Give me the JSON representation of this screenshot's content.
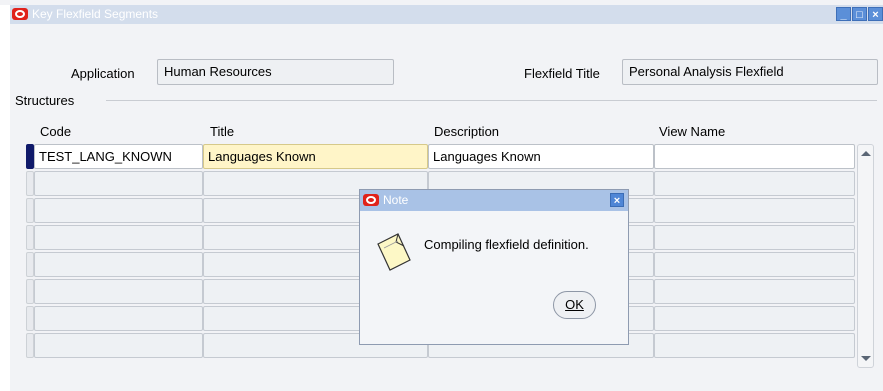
{
  "window": {
    "title": "Key Flexfield Segments",
    "controls": [
      "minimize",
      "maximize",
      "close"
    ]
  },
  "header": {
    "application_label": "Application",
    "application_value": "Human Resources",
    "flexfield_title_label": "Flexfield Title",
    "flexfield_title_value": "Personal Analysis Flexfield"
  },
  "structures": {
    "group_label": "Structures",
    "columns": [
      "Code",
      "Title",
      "Description",
      "View Name"
    ],
    "rows": [
      {
        "code": "TEST_LANG_KNOWN",
        "title": "Languages Known",
        "description": "Languages Known",
        "view_name": ""
      },
      {
        "code": "",
        "title": "",
        "description": "",
        "view_name": ""
      },
      {
        "code": "",
        "title": "",
        "description": "",
        "view_name": ""
      },
      {
        "code": "",
        "title": "",
        "description": "",
        "view_name": ""
      },
      {
        "code": "",
        "title": "",
        "description": "",
        "view_name": ""
      },
      {
        "code": "",
        "title": "",
        "description": "",
        "view_name": ""
      },
      {
        "code": "",
        "title": "",
        "description": "",
        "view_name": ""
      },
      {
        "code": "",
        "title": "",
        "description": "",
        "view_name": ""
      }
    ]
  },
  "dialog": {
    "title": "Note",
    "message": "Compiling flexfield definition.",
    "ok_label": "OK",
    "icon": "note-paper-icon"
  },
  "colors": {
    "title_bar": "#d3ddec",
    "dialog_title_bar": "#a9c2e6",
    "selected_cell": "#fff5c8",
    "row_marker_active": "#101a6a",
    "oracle_red": "#e0221b"
  }
}
